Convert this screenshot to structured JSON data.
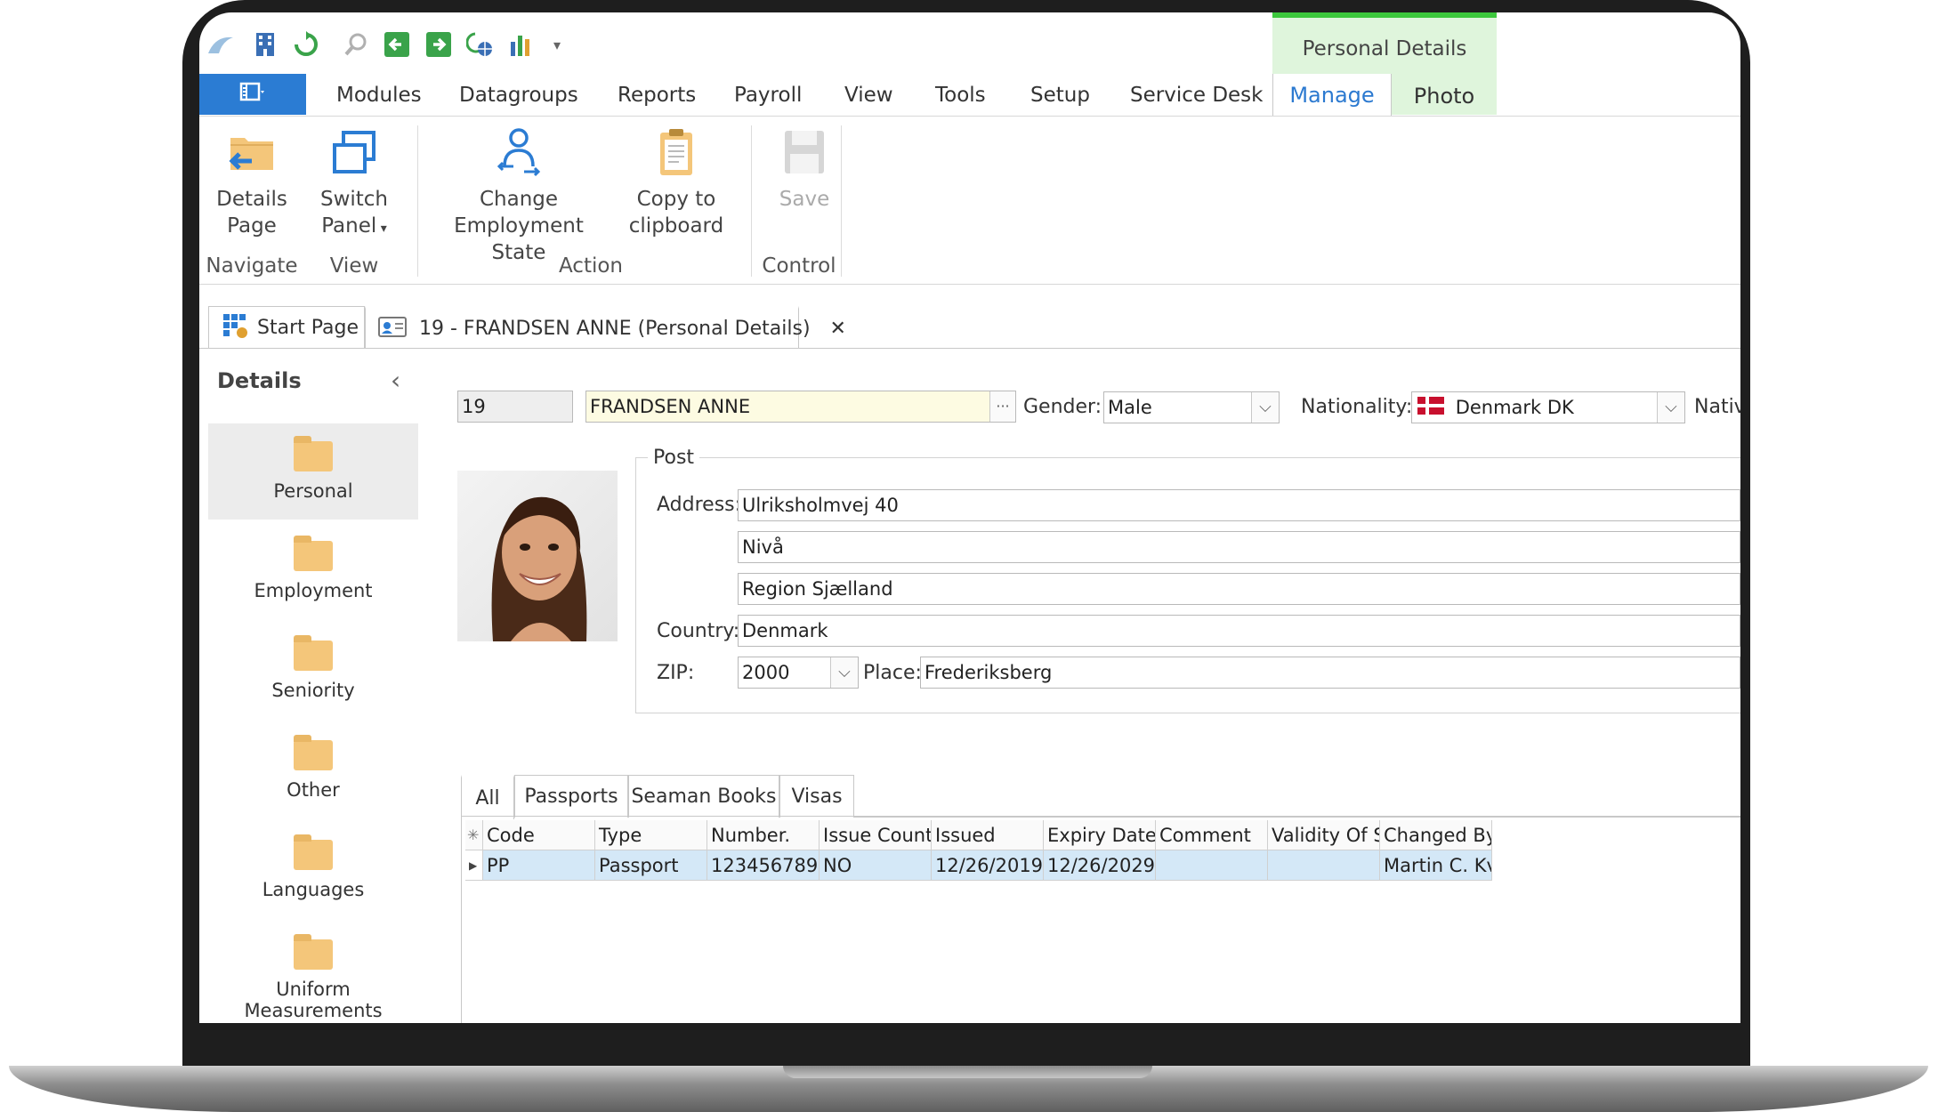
{
  "colors": {
    "accent": "#2b7cd3",
    "context_tab_bg": "#dff5dc",
    "context_tab_border": "#3cc83c",
    "name_field_bg": "#fdfbe2",
    "grid_selected_row": "#d4e8f7"
  },
  "quick_access_icons": [
    "app-logo-icon",
    "building-icon",
    "refresh-icon",
    "search-icon",
    "back-icon",
    "forward-icon",
    "globe-refresh-icon",
    "chart-icon",
    "customize-icon"
  ],
  "context_tab_group": "Personal Details",
  "menu": {
    "items": [
      "Modules",
      "Datagroups",
      "Reports",
      "Payroll",
      "View",
      "Tools",
      "Setup",
      "Service Desk"
    ],
    "manage": "Manage",
    "photo": "Photo"
  },
  "ribbon": {
    "details_page": [
      "Details",
      "Page"
    ],
    "switch_panel": [
      "Switch",
      "Panel"
    ],
    "change_employment_state": [
      "Change",
      "Employment State"
    ],
    "copy_to_clipboard": [
      "Copy to",
      "clipboard"
    ],
    "save": "Save",
    "groups": {
      "navigate": "Navigate",
      "view": "View",
      "action": "Action",
      "control": "Control"
    }
  },
  "doc_tabs": {
    "start_page": "Start Page",
    "record": "19 - FRANDSEN ANNE (Personal Details)",
    "close": "✕"
  },
  "sidebar": {
    "title": "Details",
    "items": [
      "Personal",
      "Employment",
      "Seniority",
      "Other",
      "Languages",
      "Uniform Measurements"
    ]
  },
  "header_fields": {
    "id": "19",
    "name": "FRANDSEN ANNE",
    "gender_label": "Gender:",
    "gender": "Male",
    "nationality_label": "Nationality:",
    "nationality": "Denmark DK",
    "nativity_label": "Nativ"
  },
  "post": {
    "title": "Post",
    "address_label": "Address:",
    "address1": "Ulriksholmvej 40",
    "address2": "Nivå",
    "address3": "Region Sjælland",
    "country_label": "Country:",
    "country": "Denmark",
    "zip_label": "ZIP:",
    "zip": "2000",
    "place_label": "Place:",
    "place": "Frederiksberg"
  },
  "doc_subtabs": [
    "All",
    "Passports",
    "Seaman Books",
    "Visas"
  ],
  "grid": {
    "columns": [
      "Code",
      "Type",
      "Number.",
      "Issue Countr",
      "Issued",
      "Expiry Date",
      "Comment",
      "Validity Of S",
      "Changed By"
    ],
    "rows": [
      [
        "PP",
        "Passport",
        "123456789",
        "NO",
        "12/26/2019",
        "12/26/2029",
        "",
        "",
        "Martin C. Kv"
      ]
    ]
  }
}
